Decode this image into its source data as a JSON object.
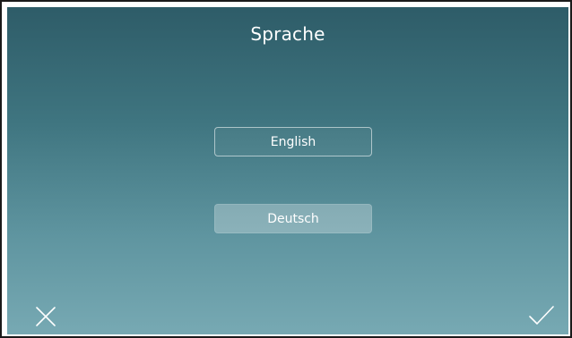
{
  "screen": {
    "title": "Sprache"
  },
  "languages": [
    {
      "label": "English",
      "selected": false
    },
    {
      "label": "Deutsch",
      "selected": true
    }
  ],
  "actions": {
    "cancel_icon": "close-icon",
    "confirm_icon": "check-icon"
  },
  "colors": {
    "background_top": "#2e5c68",
    "background_bottom": "#77a9b3",
    "text": "#ffffff"
  }
}
